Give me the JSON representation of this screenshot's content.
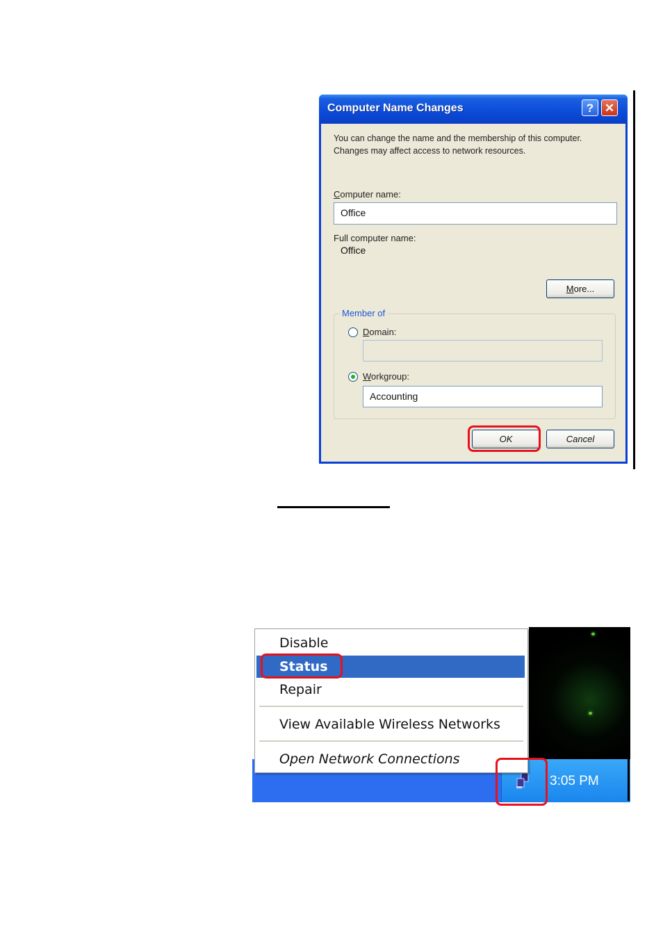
{
  "dialog": {
    "title": "Computer Name Changes",
    "help_icon": "?",
    "close_icon": "✕",
    "description": "You can change the name and the membership of this computer. Changes may affect access to network resources.",
    "computer_name_label_first": "C",
    "computer_name_label_rest": "omputer name:",
    "computer_name_value": "Office",
    "full_name_label": "Full computer name:",
    "full_name_value": "Office",
    "more_button_first": "M",
    "more_button_rest": "ore...",
    "member_of_legend": "Member of",
    "domain_label_first": "D",
    "domain_label_rest": "omain:",
    "domain_value": "",
    "domain_selected": false,
    "workgroup_label_first": "W",
    "workgroup_label_rest": "orkgroup:",
    "workgroup_value": "Accounting",
    "workgroup_selected": true,
    "ok_button": "OK",
    "cancel_button": "Cancel"
  },
  "context_menu": {
    "items": [
      {
        "label": "Disable"
      },
      {
        "label": "Status",
        "selected": true
      },
      {
        "label": "Repair"
      },
      {
        "label": "View Available Wireless Networks"
      },
      {
        "label": "Open Network Connections",
        "italic": true
      }
    ]
  },
  "taskbar": {
    "clock": "3:05 PM",
    "tray_icon": "network-connection-icon"
  },
  "highlights": {
    "color": "#e8111b",
    "targets": [
      "ok-button",
      "menu-item-status",
      "network-tray-icon"
    ]
  }
}
